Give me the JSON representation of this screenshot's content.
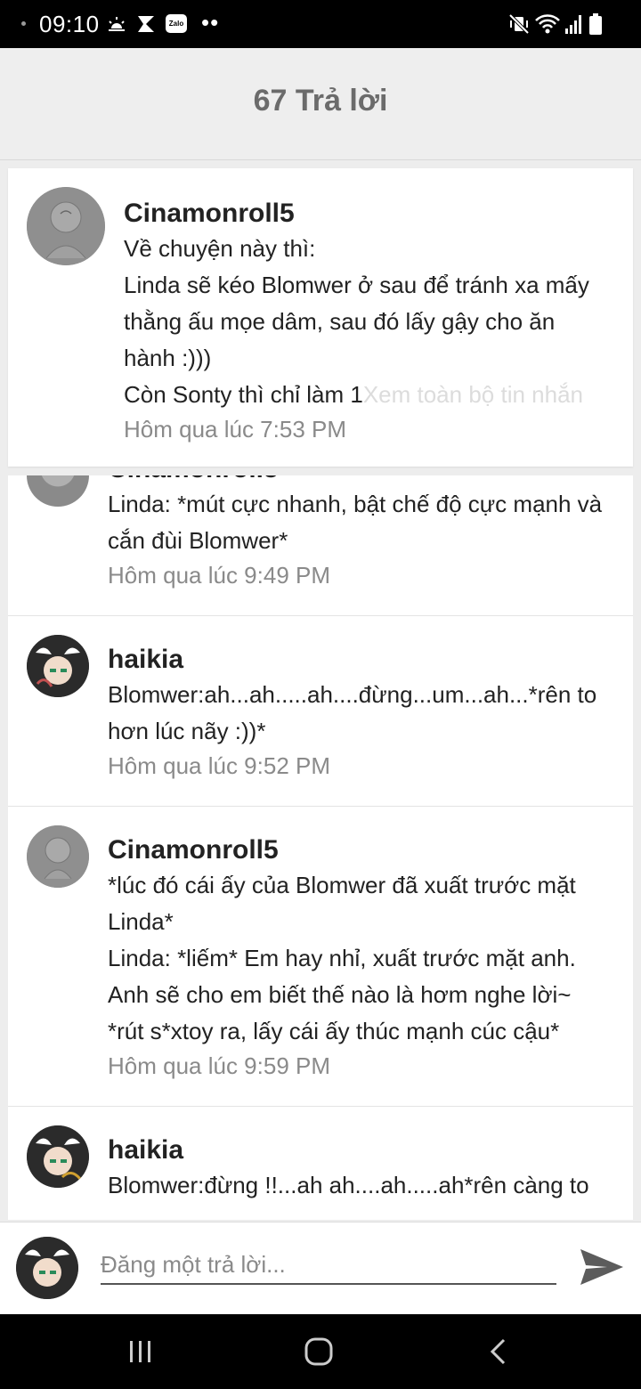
{
  "status_bar": {
    "time": "09:10",
    "zalo_label": "Zalo",
    "more": "••"
  },
  "header": {
    "title": "67 Trả lời"
  },
  "original_post": {
    "author": "Cinamonroll5",
    "lines": [
      "Về chuyện này thì:",
      "Linda sẽ kéo Blomwer ở sau để tránh xa mấy",
      "thằng ấu mọe dâm, sau đó lấy gậy cho ăn",
      "hành :)))"
    ],
    "last_line_start": "Còn Sonty thì chỉ làm 1",
    "see_more": "Xem toàn bộ tin nhắn",
    "time": "Hôm qua lúc 7:53 PM"
  },
  "comments": [
    {
      "author": "Cinamonroll5",
      "lines": [
        "Linda: *mút cực nhanh, bật chế độ cực mạnh và",
        "cắn đùi Blomwer*"
      ],
      "time": "Hôm qua lúc 9:49 PM"
    },
    {
      "author": "haikia",
      "lines": [
        "Blomwer:ah...ah.....ah....đừng...um...ah...*rên to",
        "hơn lúc nãy :))*"
      ],
      "time": "Hôm qua lúc 9:52 PM"
    },
    {
      "author": "Cinamonroll5",
      "lines": [
        "*lúc đó cái ấy của Blomwer đã xuất trước mặt",
        "Linda*",
        "Linda: *liếm* Em hay nhỉ, xuất trước mặt anh.",
        "Anh sẽ cho em biết thế nào là hơm nghe lời~",
        "*rút s*xtoy ra, lấy cái ấy thúc mạnh cúc cậu*"
      ],
      "time": "Hôm qua lúc 9:59 PM"
    },
    {
      "author": "haikia",
      "lines": [
        "Blomwer:đừng !!...ah ah....ah.....ah*rên càng to"
      ],
      "time": ""
    }
  ],
  "composer": {
    "placeholder": "Đăng một trả lời..."
  },
  "colors": {
    "header_bg": "#eeeeee",
    "title": "#6b6b6b",
    "timestamp": "#8a8a8a",
    "see_more": "#dcdcdc"
  }
}
